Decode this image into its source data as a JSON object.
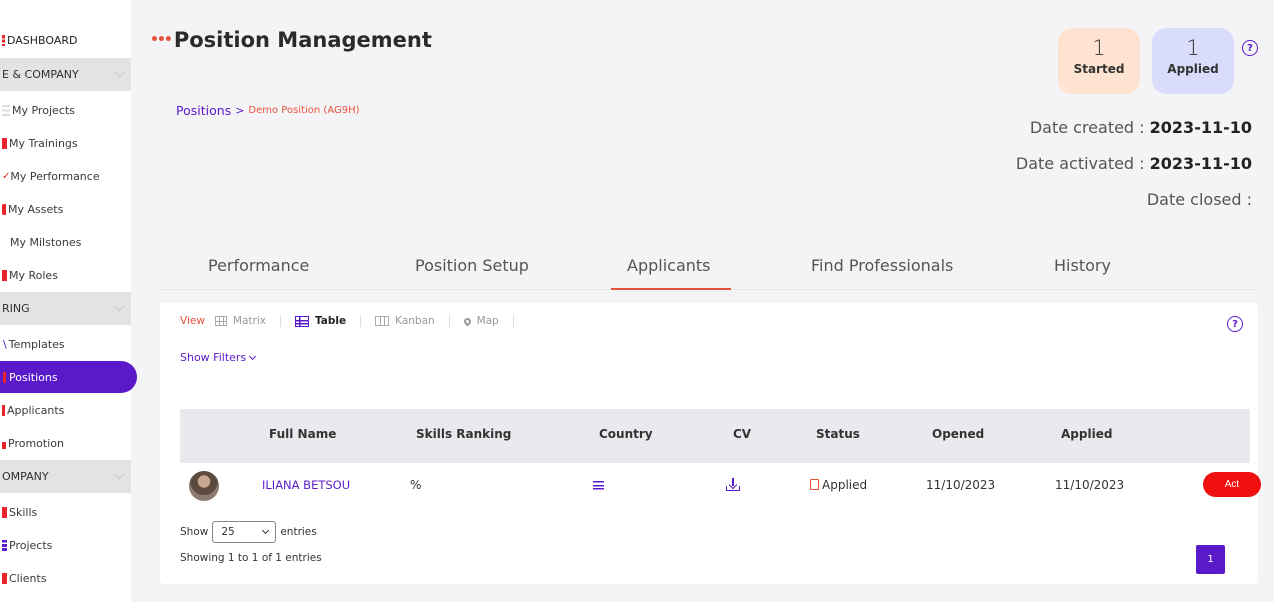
{
  "colors": {
    "accent": "#5a1ac9",
    "brand_orange": "#e6533c",
    "danger": "#f00f0f"
  },
  "sidebar": {
    "dashboard": "DASHBOARD",
    "sections": [
      "E & COMPANY",
      "RING",
      "OMPANY"
    ],
    "items": [
      {
        "label": "My Projects",
        "mark": ""
      },
      {
        "label": "My Trainings",
        "mark": "#e8232a"
      },
      {
        "label": "My Performance",
        "mark": "#e8232a"
      },
      {
        "label": "My Assets",
        "mark": "#e8232a"
      },
      {
        "label": "My Milstones",
        "mark": ""
      },
      {
        "label": "My Roles",
        "mark": "#e8232a"
      },
      {
        "label": "Templates",
        "mark": "#5a1ac9"
      },
      {
        "label": "Positions",
        "mark": "#e8232a"
      },
      {
        "label": "Applicants",
        "mark": "#e8232a"
      },
      {
        "label": "Promotion",
        "mark": "#e8232a"
      },
      {
        "label": "Skills",
        "mark": "#e8232a"
      },
      {
        "label": "Projects",
        "mark": "#5a1ac9"
      },
      {
        "label": "Clients",
        "mark": "#e8232a"
      }
    ]
  },
  "header": {
    "title": "Position Management",
    "breadcrumb": {
      "root": "Positions",
      "separator": ">",
      "current": "Demo Position (AG9H)"
    }
  },
  "stats": {
    "started": {
      "count": "1",
      "label": "Started"
    },
    "applied": {
      "count": "1",
      "label": "Applied"
    }
  },
  "dates": {
    "created_label": "Date created :",
    "created_value": "2023-11-10",
    "activated_label": "Date activated :",
    "activated_value": "2023-11-10",
    "closed_label": "Date closed :"
  },
  "tabs": [
    "Performance",
    "Position Setup",
    "Applicants",
    "Find Professionals",
    "History"
  ],
  "active_tab": "Applicants",
  "view_bar": {
    "label": "View",
    "options": [
      "Matrix",
      "Table",
      "Kanban",
      "Map"
    ],
    "active": "Table"
  },
  "filters": {
    "toggle_label": "Show Filters"
  },
  "table": {
    "headers": [
      "Full Name",
      "Skills Ranking",
      "Country",
      "CV",
      "Status",
      "Opened",
      "Applied"
    ],
    "rows": [
      {
        "name": "ILIANA BETSOU",
        "skills": "%",
        "status": "Applied",
        "opened": "11/10/2023",
        "applied": "11/10/2023",
        "action": "Act"
      }
    ]
  },
  "pagination": {
    "show_label": "Show",
    "page_size": "25",
    "entries_label": "entries",
    "info": "Showing 1 to 1 of 1 entries",
    "current_page": "1"
  }
}
